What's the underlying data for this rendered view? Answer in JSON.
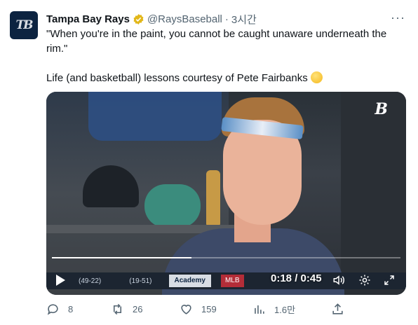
{
  "author": {
    "avatar_text": "TB",
    "name": "Tampa Bay Rays",
    "handle": "@RaysBaseball",
    "separator": "·",
    "time": "3시간"
  },
  "tweet": {
    "line1": "\"When you're in the paint, you cannot be caught unaware underneath the rim.\"",
    "line2": "Life (and basketball) lessons courtesy of Pete Fairbanks"
  },
  "video": {
    "brand_logo": "B",
    "time_display": "0:18 / 0:45",
    "progress": 0.4,
    "ticker": [
      "(49-22)",
      "(19-51)",
      "Academy",
      "MLB"
    ]
  },
  "actions": {
    "replies": "8",
    "retweets": "26",
    "likes": "159",
    "views": "1.6만"
  },
  "colors": {
    "text_secondary": "#536471",
    "verified_gold": "#e2b719",
    "rays_navy": "#0c2340"
  }
}
